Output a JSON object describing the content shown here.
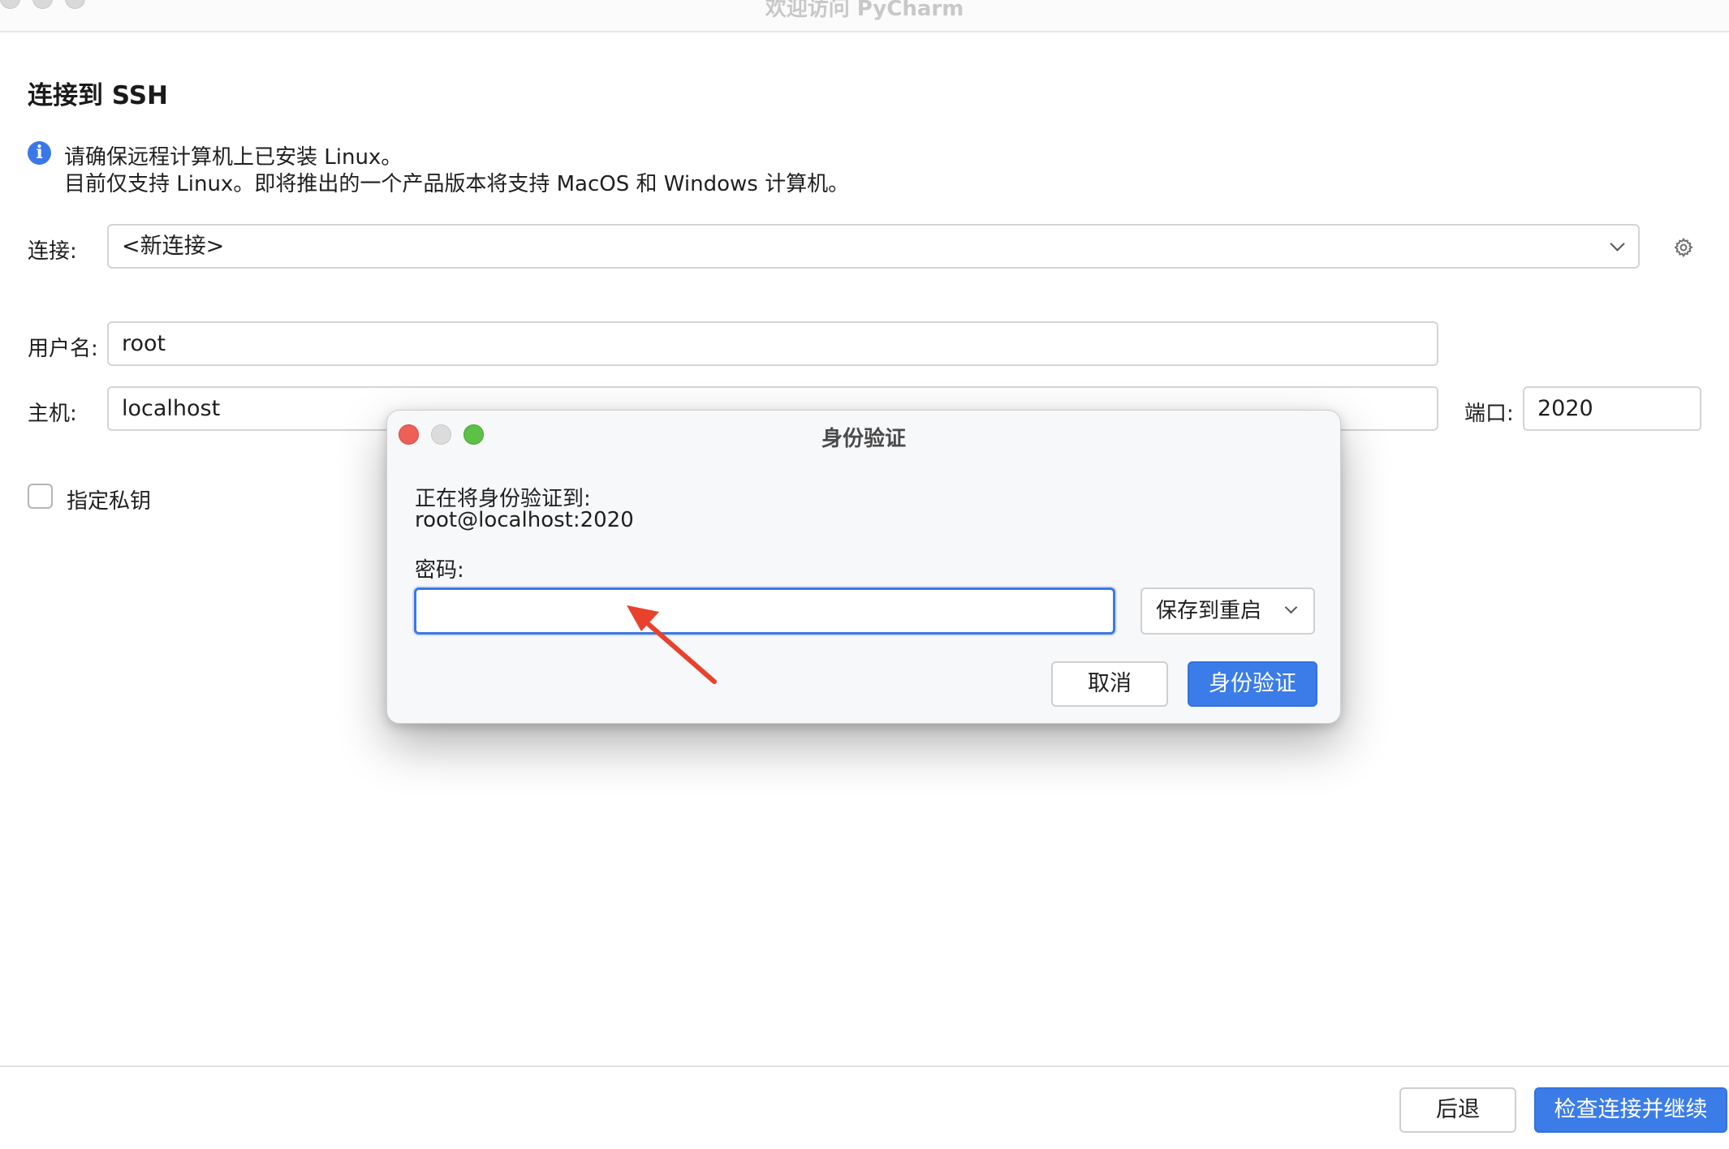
{
  "window": {
    "title": "欢迎访问 PyCharm"
  },
  "page": {
    "title": "连接到 SSH",
    "info_lines": [
      "请确保远程计算机上已安装 Linux。",
      "目前仅支持 Linux。即将推出的一个产品版本将支持 MacOS 和 Windows 计算机。"
    ]
  },
  "form": {
    "connection_label": "连接:",
    "connection_value": "<新连接>",
    "username_label": "用户名:",
    "username_value": "root",
    "host_label": "主机:",
    "host_value": "localhost",
    "port_label": "端口:",
    "port_value": "2020",
    "private_key_label": "指定私钥",
    "private_key_checked": false
  },
  "footer": {
    "back_label": "后退",
    "continue_label": "检查连接并继续"
  },
  "dialog": {
    "title": "身份验证",
    "message_line1": "正在将身份验证到:",
    "message_line2": "root@localhost:2020",
    "password_label": "密码:",
    "password_value": "",
    "save_option": "保存到重启",
    "cancel_label": "取消",
    "auth_label": "身份验证"
  },
  "colors": {
    "primary": "#3b7ce8",
    "info_icon": "#3b78e7",
    "annotation_arrow": "#e8412c",
    "close": "#ee5f57",
    "maximize": "#5cc146"
  },
  "icons": [
    "info-icon",
    "chevron-down-icon",
    "gear-icon",
    "checkbox-icon",
    "annotation-arrow-icon"
  ]
}
